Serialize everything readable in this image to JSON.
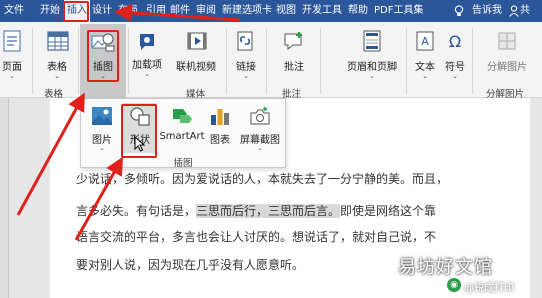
{
  "menubar": {
    "tabs": [
      {
        "label": "文件"
      },
      {
        "label": "开始"
      },
      {
        "label": "插入"
      },
      {
        "label": "设计"
      },
      {
        "label": "布局"
      },
      {
        "label": "引用"
      },
      {
        "label": "邮件"
      },
      {
        "label": "审阅"
      },
      {
        "label": "新建选项卡"
      },
      {
        "label": "视图"
      },
      {
        "label": "开发工具"
      },
      {
        "label": "帮助"
      },
      {
        "label": "PDF工具集"
      }
    ],
    "active_tab": "插入",
    "tell_me": "告诉我",
    "share": "共"
  },
  "ribbon": {
    "page_label": "页面",
    "table_label": "表格",
    "table_group": "表格",
    "illustrations_label": "插图",
    "addins_label": "加载项",
    "online_video_label": "联机视频",
    "media_group": "媒体",
    "links_label": "链接",
    "comment_label": "批注",
    "comment_group": "批注",
    "header_footer_label": "页眉和页脚",
    "text_label": "文本",
    "symbols_label": "符号",
    "split_label": "分解图片",
    "split_group": "分解图片"
  },
  "dropdown": {
    "picture_label": "图片",
    "shapes_label": "形状",
    "smartart_label": "SmartArt",
    "chart_label": "图表",
    "screenshot_label": "屏幕截图",
    "group_label": "插图"
  },
  "document": {
    "line1": "少说话，多倾听。因为爱说话的人，本就失去了一分宁静的美。而且，",
    "line2_a": "言多必失。有句话是，",
    "line2_hl": "三思而后行，三思而后言。",
    "line2_b": "即使是网络这个靠",
    "line3": "语言交流的平台，多言也会让人讨厌的。想说话了，就对自己说，不",
    "line4": "要对别人说，因为现在几乎没有人愿意听。"
  },
  "watermark": {
    "main": "易坊好文馆",
    "sub": "@锐成打印"
  },
  "colors": {
    "title_bar": "#2b579a",
    "ribbon": "#f3f3f3",
    "annotation_red": "#e0201a"
  }
}
